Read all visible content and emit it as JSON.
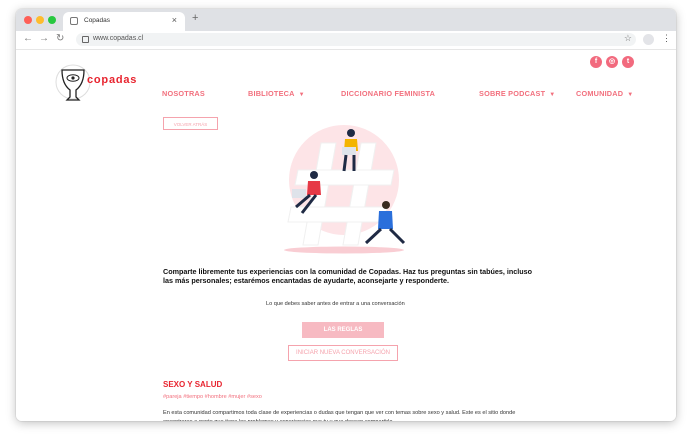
{
  "browser": {
    "tab_title": "Copadas",
    "url": "www.copadas.cl",
    "traffic_lights": [
      "#fe5f57",
      "#febc2e",
      "#28c840"
    ]
  },
  "site": {
    "logo_text": "copadas",
    "social": [
      "facebook-icon",
      "instagram-icon",
      "twitter-icon"
    ],
    "menu": [
      {
        "label": "NOSOTRAS",
        "dropdown": false
      },
      {
        "label": "BIBLIOTECA",
        "dropdown": true
      },
      {
        "label": "DICCIONARIO FEMINISTA",
        "dropdown": false
      },
      {
        "label": "SOBRE PODCAST",
        "dropdown": true
      },
      {
        "label": "COMUNIDAD",
        "dropdown": true
      }
    ],
    "small_button": "VOLVER ATRÁS",
    "description": "Comparte libremente tus experiencias con la comunidad de Copadas. Haz tus preguntas sin tabúes, incluso las más personales; estarémos encantadas de ayudarte, aconsejarte y responderte.",
    "rules_intro": "Lo que debes saber antes de entrar a una conversación",
    "rules_button": "LAS REGLAS",
    "start_button": "INICIAR NUEVA CONVERSACIÓN",
    "section_title": "SEXO Y SALUD",
    "tags": "#pareja #tiempo #hombre #mujer #sexo",
    "section_body": "En esta comunidad compartimos toda clase de experiencias o dudas que tengan que ver con temas sobre sexo y salud. Este es el sitio donde encontraras a gente que tiene los problemas y experiencias que tu y que desean compartirlo.",
    "colors": {
      "accent": "#f2707e",
      "brand_red": "#e8242f",
      "soft_pink": "#f7bac2"
    }
  }
}
